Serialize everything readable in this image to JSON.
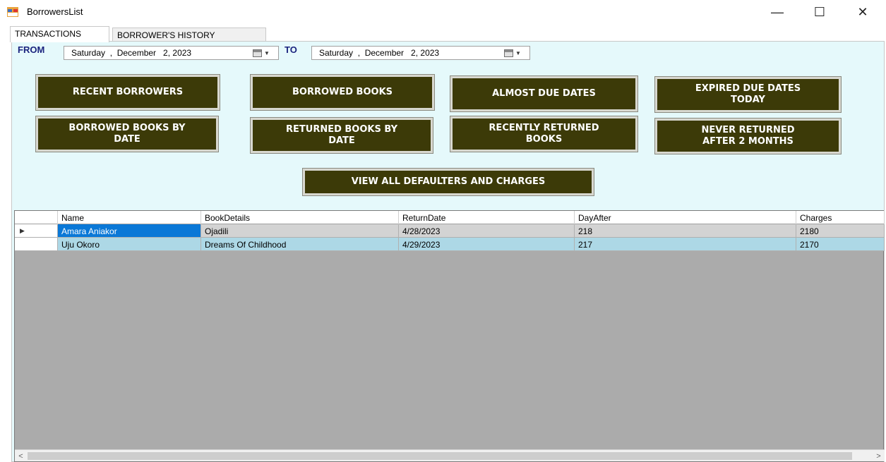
{
  "window": {
    "title": "BorrowersList",
    "minimize_glyph": "—",
    "maximize_glyph": "☐",
    "close_glyph": "✕"
  },
  "tabs": [
    {
      "label": "TRANSACTIONS",
      "active": true
    },
    {
      "label": "BORROWER'S HISTORY",
      "active": false
    }
  ],
  "filters": {
    "from_label": "FROM",
    "to_label": "TO",
    "from_value": "Saturday  ,  December   2, 2023",
    "to_value": "Saturday  ,  December   2, 2023"
  },
  "actions": {
    "recent_borrowers": "RECENT BORROWERS",
    "borrowed_books": "BORROWED BOOKS",
    "almost_due_dates": "ALMOST DUE DATES",
    "expired_due_dates_today": "EXPIRED DUE DATES\nTODAY",
    "borrowed_books_by_date": "BORROWED BOOKS BY\nDATE",
    "returned_books_by_date": "RETURNED BOOKS BY\nDATE",
    "recently_returned_books": "RECENTLY RETURNED\nBOOKS",
    "never_returned_after_2_months": "NEVER RETURNED\nAFTER 2 MONTHS",
    "view_all_defaulters": "VIEW ALL DEFAULTERS AND CHARGES"
  },
  "grid": {
    "columns": [
      "Name",
      "BookDetails",
      "ReturnDate",
      "DayAfter",
      "Charges"
    ],
    "current_row_glyph": "▶",
    "rows": [
      {
        "name": "Amara Aniakor",
        "book": "Ojadili",
        "return_date": "4/28/2023",
        "day_after": "218",
        "charges": "2180"
      },
      {
        "name": "Uju Okoro",
        "book": "Dreams Of Childhood",
        "return_date": "4/29/2023",
        "day_after": "217",
        "charges": "2170"
      }
    ],
    "scroll_left_glyph": "<",
    "scroll_right_glyph": ">"
  },
  "colors": {
    "button_bg": "#3c3a08",
    "panel_bg": "#e5f9fb",
    "selected_cell": "#0a78d7",
    "row_alt": "#add8e6",
    "grid_bg": "#ababab"
  }
}
